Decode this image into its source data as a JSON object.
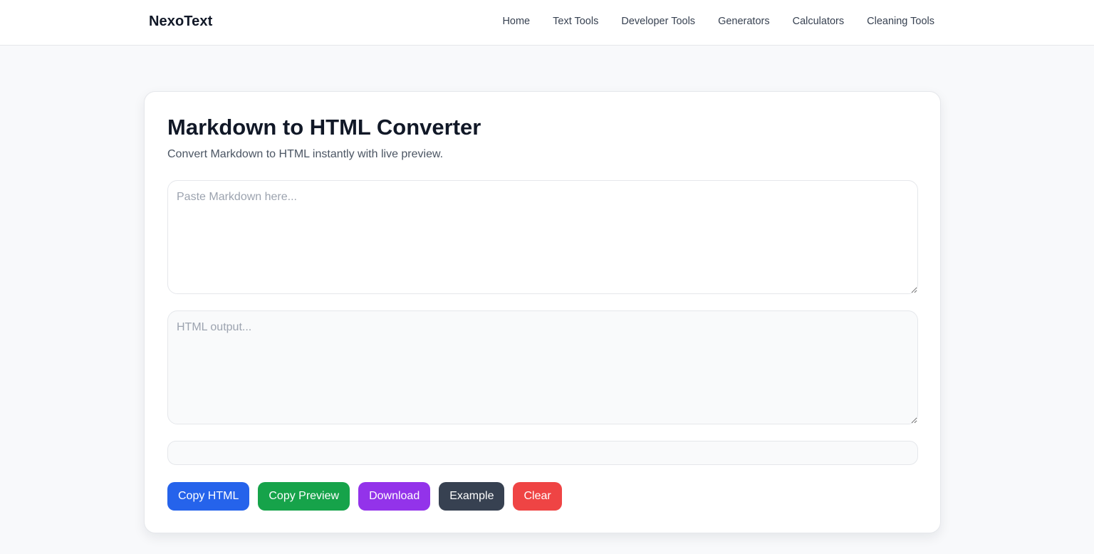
{
  "header": {
    "brand": "NexoText",
    "nav": [
      "Home",
      "Text Tools",
      "Developer Tools",
      "Generators",
      "Calculators",
      "Cleaning Tools"
    ]
  },
  "tool": {
    "title": "Markdown to HTML Converter",
    "subtitle": "Convert Markdown to HTML instantly with live preview.",
    "markdown_placeholder": "Paste Markdown here...",
    "markdown_value": "",
    "html_placeholder": "HTML output...",
    "html_value": "",
    "preview_text": ""
  },
  "actions": {
    "copy_html": "Copy HTML",
    "copy_preview": "Copy Preview",
    "download": "Download",
    "example": "Example",
    "clear": "Clear"
  },
  "colors": {
    "copy_html": "#2563eb",
    "copy_preview": "#16a34a",
    "download": "#9333ea",
    "example": "#374151",
    "clear": "#ef4444"
  }
}
